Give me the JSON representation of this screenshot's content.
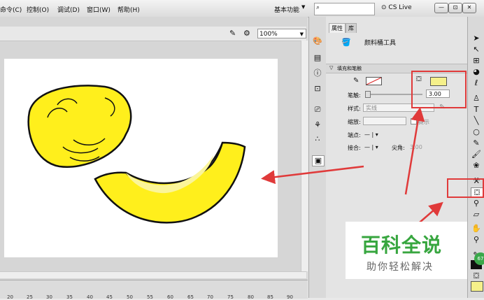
{
  "menu": [
    "命令(C)",
    "控制(O)",
    "调试(D)",
    "窗口(W)",
    "帮助(H)"
  ],
  "workspace": "基本功能",
  "search_placeholder": "",
  "cs_live": "CS Live",
  "window_controls": [
    "—",
    "⊡",
    "✕"
  ],
  "zoom": "100%",
  "ruler": [
    "20",
    "25",
    "30",
    "35",
    "40",
    "45",
    "50",
    "55",
    "60",
    "65",
    "70",
    "75",
    "80",
    "85",
    "90"
  ],
  "panel": {
    "tabs": [
      "属性",
      "库"
    ],
    "tool_name": "颜料桶工具",
    "section": "填充和笔触",
    "stroke_label": "笔触:",
    "stroke_value": "3.00",
    "style_label": "样式:",
    "style_value": "实线",
    "scale_label": "缩放:",
    "hint_label": "提示",
    "cap_label": "端点:",
    "join_label": "接合:",
    "miter_label": "尖角:",
    "miter_value": "3.00"
  },
  "colors": {
    "fill": "#f5f08a",
    "shape_fill": "#ffef1c",
    "annotation": "#e03a3a"
  },
  "watermark": {
    "title": "百科全说",
    "subtitle": "助你轻松解决"
  },
  "badge": "67"
}
